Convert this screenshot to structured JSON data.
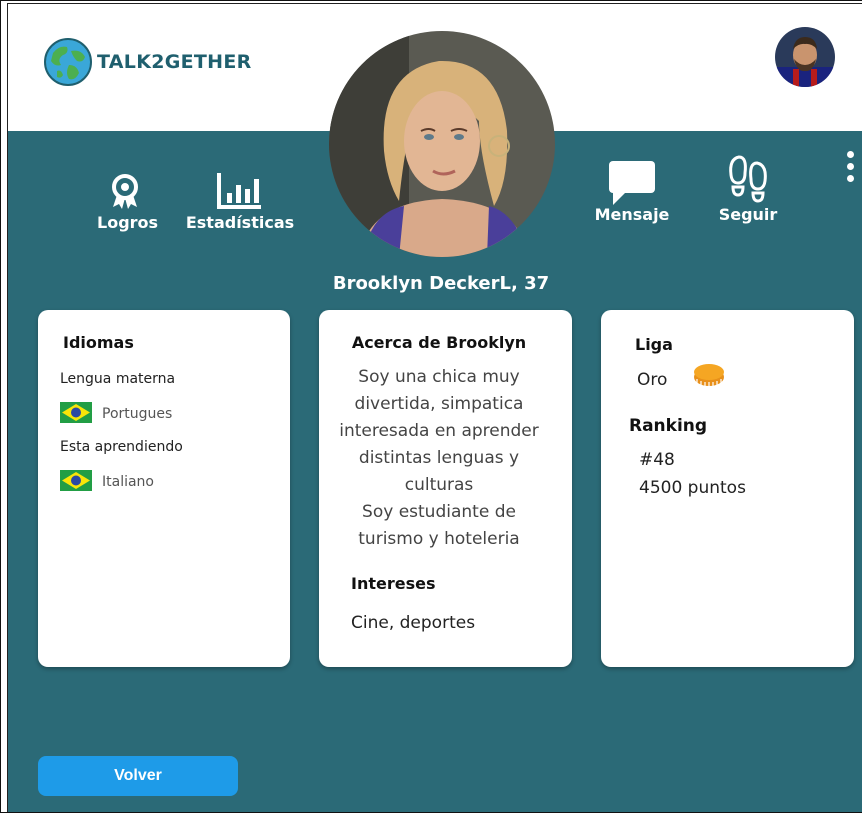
{
  "brand": {
    "name": "TALK2GETHER"
  },
  "header": {
    "user_avatar_icon": "profile-photo",
    "profile_photo_icon": "profile-photo"
  },
  "actions": {
    "logros": "Logros",
    "estadisticas": "Estadísticas",
    "mensaje": "Mensaje",
    "seguir": "Seguir"
  },
  "profile": {
    "name_age": "Brooklyn DeckerL, 37"
  },
  "idiomas": {
    "title": "Idiomas",
    "native_label": "Lengua materna",
    "native_language": "Portugues",
    "learning_label": "Esta aprendiendo",
    "learning_language": "Italiano"
  },
  "about": {
    "title": "Acerca de Brooklyn",
    "lines": [
      "Soy una chica muy",
      "divertida, simpatica",
      "interesada en aprender",
      "distintas lenguas y",
      "culturas",
      "Soy estudiante de",
      "turismo y hoteleria"
    ],
    "interests_title": "Intereses",
    "interests": "Cine, deportes"
  },
  "liga": {
    "title": "Liga",
    "value": "Oro",
    "ranking_title": "Ranking",
    "rank": "#48",
    "points": "4500 puntos"
  },
  "footer": {
    "back_label": "Volver"
  },
  "colors": {
    "teal": "#2b6a77",
    "button": "#1e9be8",
    "gold": "#f5a623"
  }
}
